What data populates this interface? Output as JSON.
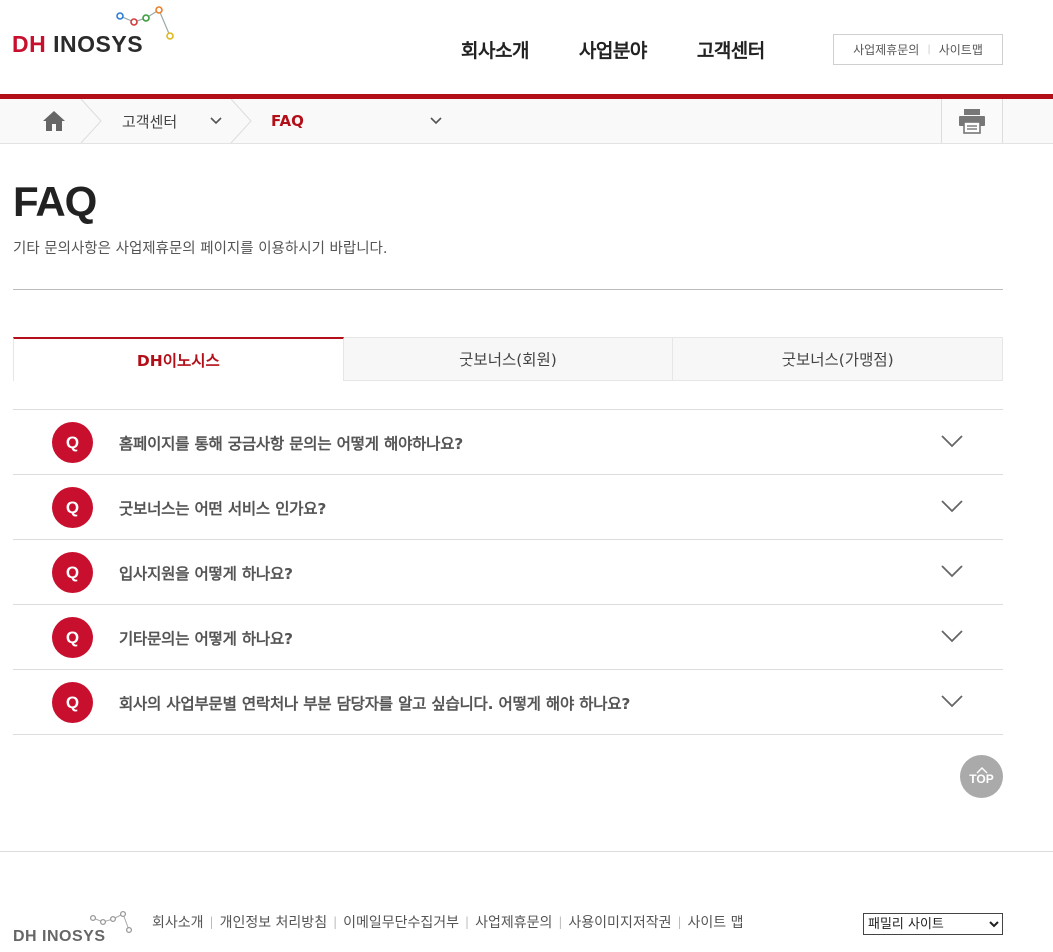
{
  "header": {
    "logo_dh": "DH",
    "logo_inosys": "INOSYS",
    "nav": [
      "회사소개",
      "사업분야",
      "고객센터"
    ],
    "util_links": [
      "사업제휴문의",
      "사이트맵"
    ]
  },
  "location": {
    "level1": "고객센터",
    "level2": "FAQ"
  },
  "page": {
    "title": "FAQ",
    "description": "기타 문의사항은 사업제휴문의 페이지를 이용하시기 바랍니다."
  },
  "tabs": [
    {
      "label": "DH이노시스",
      "active": true
    },
    {
      "label": "굿보너스(회원)",
      "active": false
    },
    {
      "label": "굿보너스(가맹점)",
      "active": false
    }
  ],
  "faq": {
    "badge": "Q",
    "items": [
      "홈페이지를 통해 궁금사항 문의는 어떻게 해야하나요?",
      "굿보너스는 어떤 서비스 인가요?",
      "입사지원을 어떻게 하나요?",
      "기타문의는 어떻게 하나요?",
      "회사의 사업부문별 연락처나 부분 담당자를 알고 싶습니다. 어떻게 해야 하나요?"
    ]
  },
  "top_button": "TOP",
  "footer": {
    "logo": "DH INOSYS",
    "links": [
      "회사소개",
      "개인정보 처리방침",
      "이메일무단수집거부",
      "사업제휴문의",
      "사용이미지저작권",
      "사이트 맵"
    ],
    "family_site": "패밀리 사이트"
  },
  "colors": {
    "brand_red": "#c8102e",
    "accent_line": "#b20f18"
  }
}
